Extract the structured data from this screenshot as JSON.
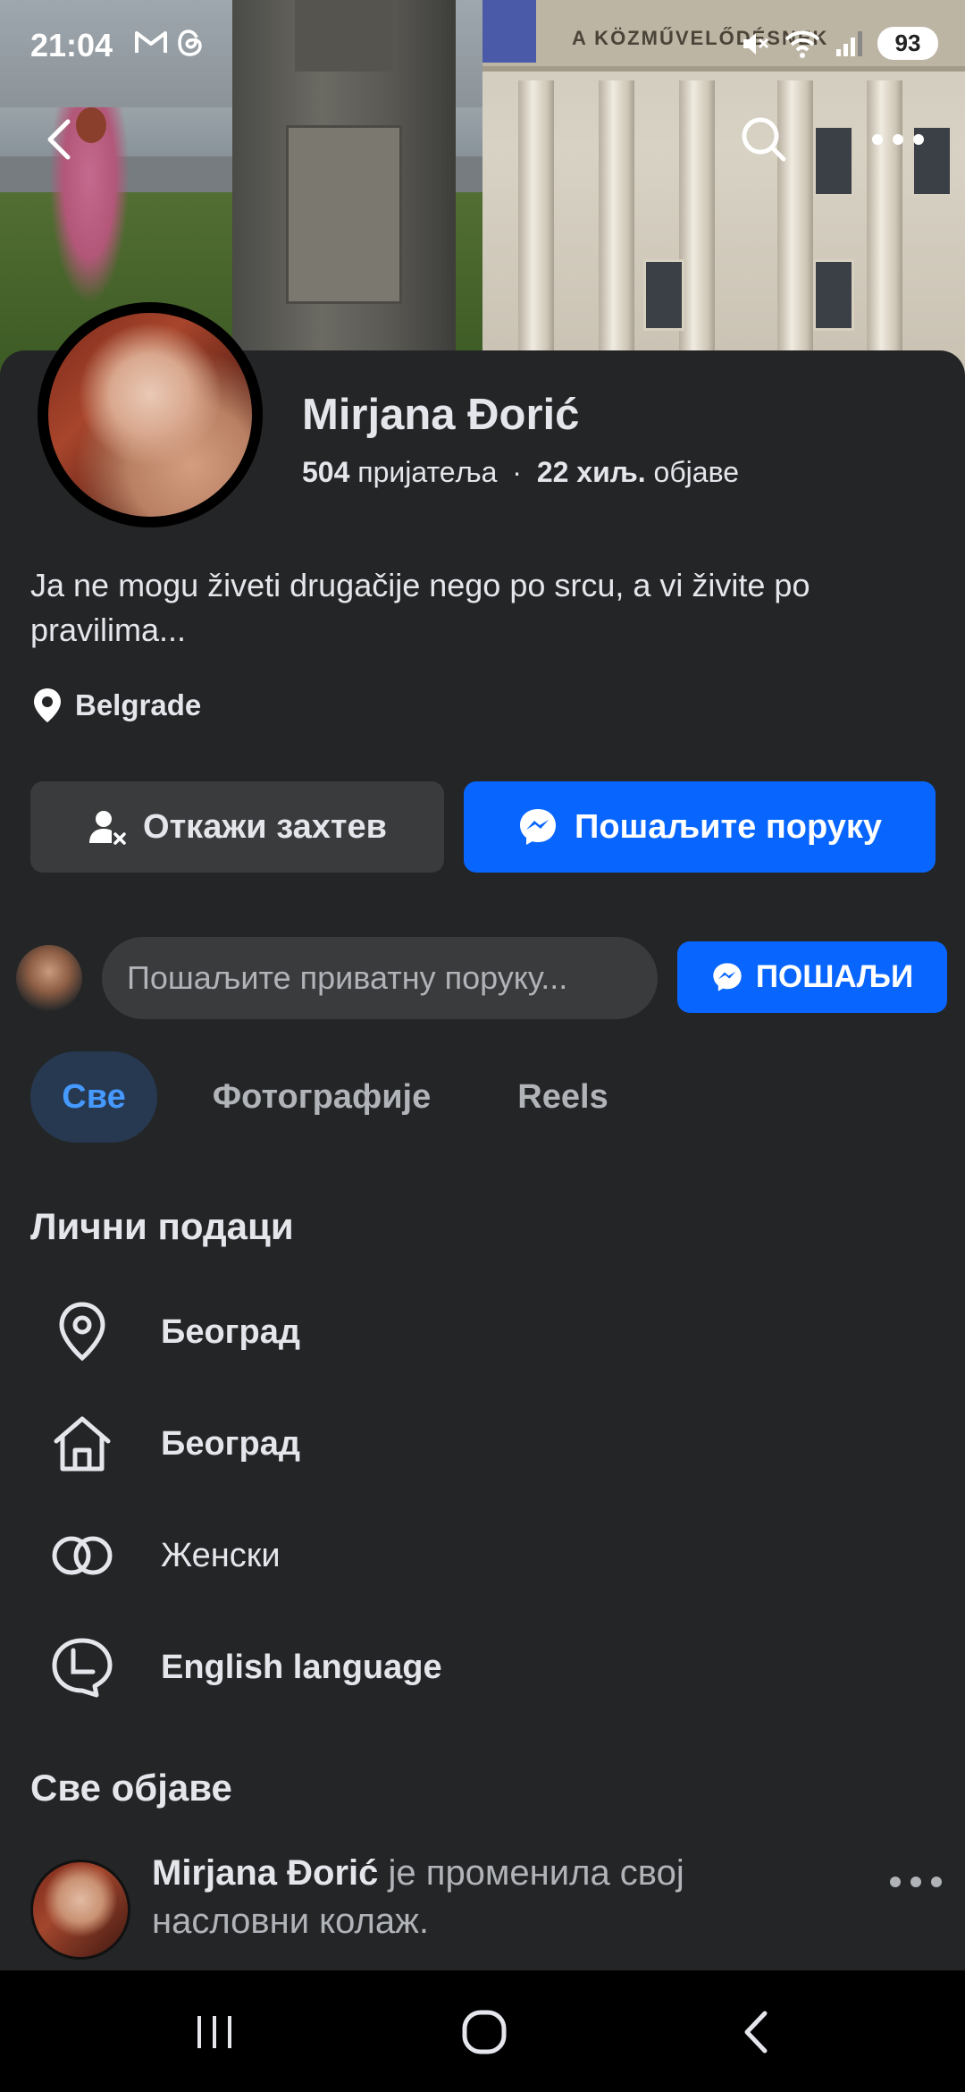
{
  "status_bar": {
    "time": "21:04",
    "left_icons": [
      "gmail-icon",
      "threads-icon"
    ],
    "right_icons": [
      "mute-icon",
      "wifi-icon",
      "signal-icon"
    ],
    "battery": "93"
  },
  "cover": {
    "building_text": "A KÖZMŰVELŐDÉSNEK"
  },
  "profile": {
    "name": "Mirjana Đorić",
    "friends_count": "504",
    "friends_label": "пријатеља",
    "separator": "·",
    "posts_count": "22 хиљ.",
    "posts_label": "објаве",
    "bio": "Ja ne mogu živeti drugačije nego po srcu, a vi živite po pravilima...",
    "location": "Belgrade"
  },
  "actions": {
    "cancel_request": "Откажи захтев",
    "send_message": "Пошаљите поруку"
  },
  "private_message": {
    "placeholder": "Пошаљите приватну поруку...",
    "send_label": "ПОШАЉИ"
  },
  "tabs": [
    {
      "label": "Све",
      "active": true
    },
    {
      "label": "Фотографије",
      "active": false
    },
    {
      "label": "Reels",
      "active": false
    }
  ],
  "personal_details": {
    "title": "Лични подаци",
    "items": [
      {
        "icon": "location-pin-icon",
        "label": "Београд",
        "bold": true
      },
      {
        "icon": "home-icon",
        "label": "Београд",
        "bold": true
      },
      {
        "icon": "gender-icon",
        "label": "Женски",
        "bold": false
      },
      {
        "icon": "language-icon",
        "label": "English language",
        "bold": true
      }
    ]
  },
  "posts": {
    "title": "Све објаве",
    "first": {
      "author": "Mirjana Đorić",
      "action": "је променила свој насловни колаж."
    }
  },
  "colors": {
    "background": "#242526",
    "primary_blue": "#0866ff",
    "active_tab_bg": "#263951",
    "active_tab_text": "#4599ff",
    "secondary_button": "#3a3b3c"
  }
}
